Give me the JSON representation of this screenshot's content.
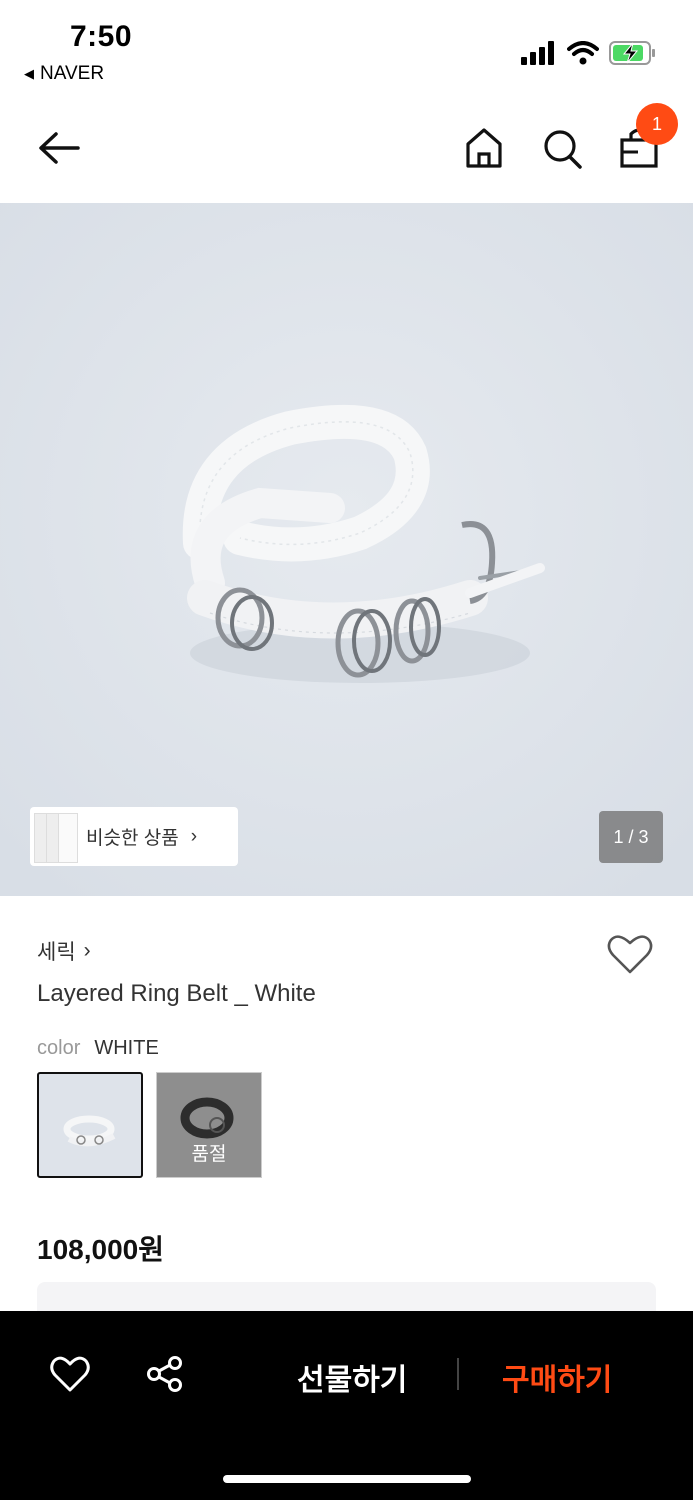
{
  "status_bar": {
    "time": "7:50",
    "back_app": "NAVER",
    "back_arrow": "◀",
    "icons": [
      "signal-icon",
      "wifi-icon",
      "battery-charging-icon"
    ]
  },
  "nav": {
    "back_icon": "arrow-left-icon",
    "home_icon": "home-icon",
    "search_icon": "search-icon",
    "cart_icon": "shopping-bag-icon",
    "cart_badge": "1"
  },
  "gallery": {
    "similar_label": "비슷한 상품",
    "similar_chevron": "›",
    "pager": "1 / 3"
  },
  "product": {
    "brand": "세릭",
    "brand_chevron": "›",
    "title": "Layered Ring Belt _ White",
    "option_key": "color",
    "option_value": "WHITE",
    "swatches": [
      {
        "name": "white",
        "sold_out": ""
      },
      {
        "name": "black",
        "sold_out": "품절"
      }
    ],
    "price": "108,000원"
  },
  "bottom_bar": {
    "gift_label": "선물하기",
    "buy_label": "구매하기"
  },
  "colors": {
    "accent": "#ff4b14",
    "bar_bg": "#000000",
    "hero_bg": "#dee3ea"
  }
}
